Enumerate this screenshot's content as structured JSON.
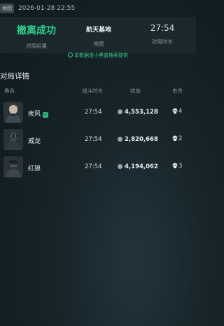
{
  "top": {
    "tag": "地图",
    "timestamp": "2026-01-28 22:55"
  },
  "summary": {
    "result": {
      "value": "撤离成功",
      "label": "对局结果",
      "color": "#27d48a"
    },
    "map": {
      "value": "航天基地",
      "label": "地图"
    },
    "duration": {
      "value": "27:54",
      "label": "对局时长"
    }
  },
  "source_note": "本数据由小黑盒搜索提供",
  "section_title": "对局详情",
  "table": {
    "headers": {
      "role": "角色",
      "battle_time": "战斗时长",
      "earnings": "收益",
      "kills": "击杀"
    },
    "rows": [
      {
        "name": "疾风",
        "badge": "✓",
        "battle_time": "27:54",
        "earnings": "4,553,128",
        "kills": "4"
      },
      {
        "name": "威龙",
        "battle_time": "27:54",
        "earnings": "2,820,668",
        "kills": "2"
      },
      {
        "name": "红狼",
        "battle_time": "27:54",
        "earnings": "4,194,062",
        "kills": "3"
      }
    ]
  },
  "icons": {
    "source": "refresh-circle-icon",
    "coin": "coin-icon",
    "kills": "skull-icon"
  }
}
